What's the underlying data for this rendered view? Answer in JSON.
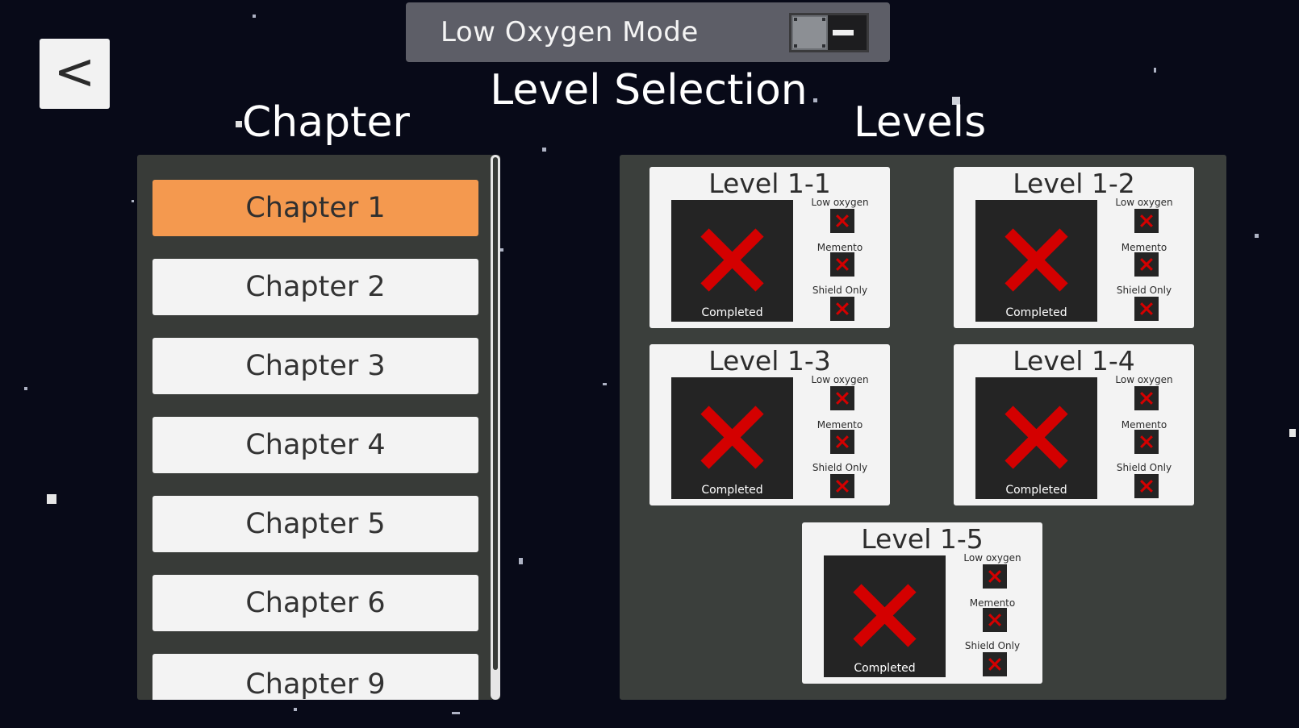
{
  "back_button": {
    "label": "<"
  },
  "low_oxygen_mode": {
    "label": "Low Oxygen Mode",
    "enabled": false
  },
  "title": "Level Selection",
  "chapters": {
    "heading": "Chapter",
    "items": [
      {
        "label": "Chapter 1",
        "selected": true
      },
      {
        "label": "Chapter 2",
        "selected": false
      },
      {
        "label": "Chapter 3",
        "selected": false
      },
      {
        "label": "Chapter 4",
        "selected": false
      },
      {
        "label": "Chapter 5",
        "selected": false
      },
      {
        "label": "Chapter 6",
        "selected": false
      },
      {
        "label": "Chapter 9",
        "selected": false
      }
    ]
  },
  "levels": {
    "heading": "Levels",
    "items": [
      {
        "name": "Level 1-1",
        "status": "Completed",
        "challenges": [
          {
            "label": "Low oxygen"
          },
          {
            "label": "Memento"
          },
          {
            "label": "Shield Only"
          }
        ]
      },
      {
        "name": "Level 1-2",
        "status": "Completed",
        "challenges": [
          {
            "label": "Low oxygen"
          },
          {
            "label": "Memento"
          },
          {
            "label": "Shield Only"
          }
        ]
      },
      {
        "name": "Level 1-3",
        "status": "Completed",
        "challenges": [
          {
            "label": "Low oxygen"
          },
          {
            "label": "Memento"
          },
          {
            "label": "Shield Only"
          }
        ]
      },
      {
        "name": "Level 1-4",
        "status": "Completed",
        "challenges": [
          {
            "label": "Low oxygen"
          },
          {
            "label": "Memento"
          },
          {
            "label": "Shield Only"
          }
        ]
      },
      {
        "name": "Level 1-5",
        "status": "Completed",
        "challenges": [
          {
            "label": "Low oxygen"
          },
          {
            "label": "Memento"
          },
          {
            "label": "Shield Only"
          }
        ]
      }
    ]
  },
  "colors": {
    "background": "#080a18",
    "selected_chapter": "#f4994f",
    "x_mark": "#d40000"
  },
  "icons": {
    "x_mark": "x-mark-icon"
  }
}
